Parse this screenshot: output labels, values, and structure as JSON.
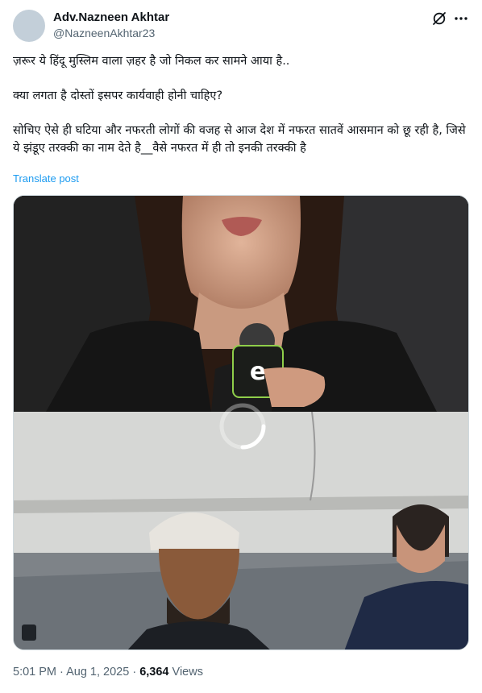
{
  "author": {
    "name": "Adv.Nazneen Akhtar",
    "handle": "@NazneenAkhtar23"
  },
  "header_icons": [
    "grok-icon",
    "more-icon"
  ],
  "post": {
    "paragraphs": [
      "ज़रूर ये हिंदू मुस्लिम वाला ज़हर है जो निकल कर सामने आया है..",
      "क्या लगता है दोस्तों इसपर कार्यवाही होनी चाहिए?",
      "सोचिए ऐसे ही घटिया और नफरती लोगों की वजह से आज देश में नफरत सातवें आसमान को छू रही है, जिसे ये झंडूए तरक्की का नाम देते है__वैसे नफरत में ही तो इनकी तरक्की है"
    ],
    "translate_label": "Translate post"
  },
  "media": {
    "type": "video",
    "state": "loading",
    "icons": [
      "loading-spinner-icon",
      "video-badge-icon"
    ]
  },
  "meta": {
    "time": "5:01 PM",
    "separator": " · ",
    "date": "Aug 1, 2025",
    "views_count": "6,364",
    "views_label": "Views"
  },
  "colors": {
    "link": "#1d9bf0",
    "secondary_text": "#536471",
    "primary_text": "#0f1419"
  }
}
